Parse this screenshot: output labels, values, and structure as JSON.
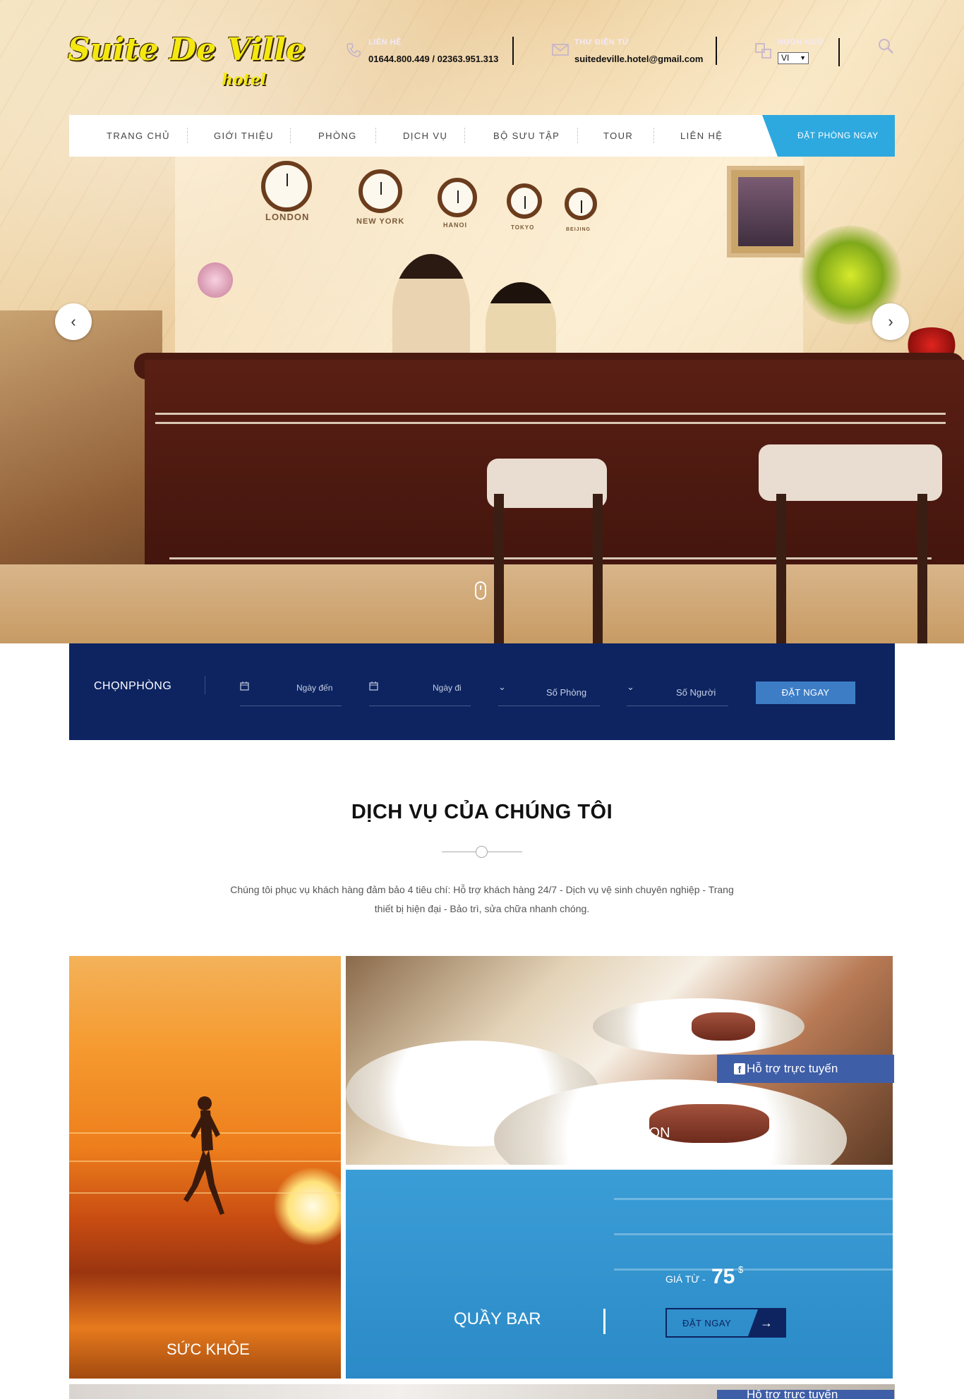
{
  "brand": {
    "logo_main": "Suite De Ville",
    "logo_sub": "hotel"
  },
  "header": {
    "contact": {
      "label": "LIÊN HỆ",
      "value": "01644.800.449 / 02363.951.313"
    },
    "email": {
      "label": "THƯ ĐIỆN TỬ",
      "value": "suitedeville.hotel@gmail.com"
    },
    "language": {
      "label": "NGÔN NGỮ",
      "selected": "VI"
    }
  },
  "nav": {
    "items": [
      "TRANG CHỦ",
      "GIỚI THIỆU",
      "PHÒNG",
      "DỊCH VỤ",
      "BỘ SƯU TẬP",
      "TOUR",
      "LIÊN HỆ"
    ],
    "cta": "ĐẶT PHÒNG NGAY"
  },
  "hero": {
    "clock_labels": [
      "LONDON",
      "NEW YORK",
      "HANOI",
      "TOKYO",
      "BEIJING"
    ],
    "prev_icon": "‹",
    "next_icon": "›"
  },
  "booking": {
    "title": "CHỌNPHÒNG",
    "arrival_placeholder": "Ngày đến",
    "departure_placeholder": "Ngày đi",
    "rooms_placeholder": "Số Phòng",
    "guests_placeholder": "Số Người",
    "submit": "ĐẶT NGAY"
  },
  "services": {
    "title": "DỊCH VỤ CỦA CHÚNG TÔI",
    "description": "Chúng tôi phục vụ khách hàng đảm bảo 4 tiêu chí: Hỗ trợ khách hàng 24/7 - Dịch vụ vệ sinh chuyên nghiệp - Trang thiết bị hiện đại - Bảo trì, sửa chữa nhanh chóng.",
    "tiles": {
      "health": "SỨC KHỎE",
      "food": "BỮA ĂN NGON",
      "bar": {
        "name": "QUẦY BAR",
        "price_label": "GIÁ TỪ -",
        "price": "75",
        "currency": "$",
        "button": "ĐẶT NGAY",
        "button_icon": "→"
      }
    }
  },
  "support": {
    "label": "Hỗ trợ trực tuyến"
  },
  "colors": {
    "navy": "#0d2461",
    "accent_blue": "#2ea9df",
    "button_blue": "#3d7dc6",
    "support_blue": "#3f5ea8"
  }
}
